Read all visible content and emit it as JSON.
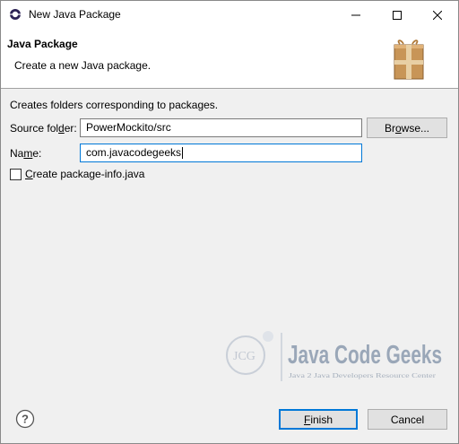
{
  "window": {
    "title": "New Java Package",
    "icon": "eclipse-icon",
    "controls": {
      "minimize": "minimize-icon",
      "maximize": "maximize-icon",
      "close": "close-icon"
    }
  },
  "banner": {
    "title": "Java Package",
    "description": "Create a new Java package.",
    "icon": "package-icon"
  },
  "form": {
    "info": "Creates folders corresponding to packages.",
    "source_folder": {
      "label_pre": "Source fol",
      "label_mnemonic": "d",
      "label_post": "er:",
      "value": "PowerMockito/src",
      "browse_pre": "Br",
      "browse_mnemonic": "o",
      "browse_post": "wse..."
    },
    "name": {
      "label_pre": "Na",
      "label_mnemonic": "m",
      "label_post": "e:",
      "value": "com.javacodegeeks"
    },
    "package_info": {
      "mnemonic": "C",
      "label_post": "reate package-info.java",
      "checked": false
    }
  },
  "watermark": {
    "logo_text": "JCG",
    "brand": "Java Code Geeks",
    "tagline": "Java 2 Java Developers Resource Center"
  },
  "footer": {
    "help_icon": "help-icon",
    "finish_mnemonic": "F",
    "finish_post": "inish",
    "cancel": "Cancel"
  },
  "colors": {
    "accent": "#0078d7",
    "watermark": "#9aa7b8"
  }
}
